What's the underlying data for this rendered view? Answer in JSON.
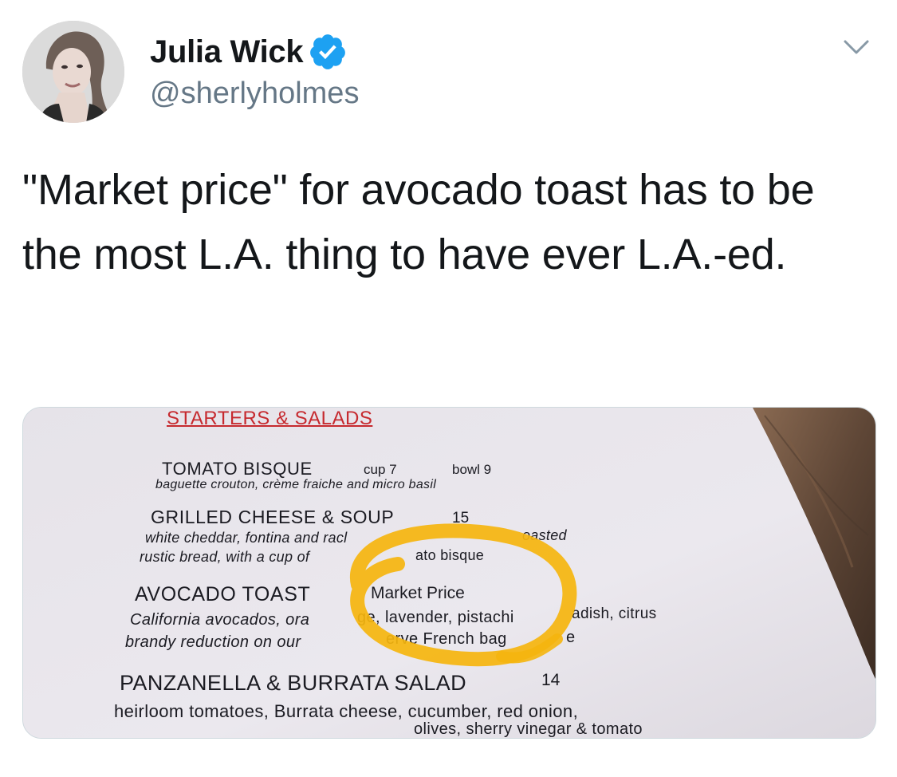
{
  "tweet": {
    "display_name": "Julia Wick",
    "handle": "@sherlyholmes",
    "text": "\"Market price\" for avocado toast has to be the most L.A. thing to have ever L.A.-ed."
  },
  "colors": {
    "verified_badge": "#1da1f2",
    "handle_gray": "#657786",
    "text_dark": "#14171a",
    "menu_red": "#c62a2f",
    "highlight_yellow": "#f5b50e"
  },
  "icons": {
    "verified": "verified-badge-icon",
    "caret": "chevron-down-icon"
  },
  "menu": {
    "section": "STARTERS & SALADS",
    "items": [
      {
        "name": "TOMATO BISQUE",
        "price_a": "cup 7",
        "price_b": "bowl 9",
        "desc": "baguette crouton, crème fraiche and micro basil"
      },
      {
        "name": "GRILLED CHEESE & SOUP",
        "price_a": "15",
        "desc_1a": "white cheddar, fontina and racl",
        "desc_1b": "oasted",
        "desc_2a": "rustic bread, with a cup of",
        "desc_2b": "ato bisque"
      },
      {
        "name": "AVOCADO TOAST",
        "price_a": "Market Price",
        "desc_1a": "California avocados, ora",
        "desc_1b": "ge, lavender, pistachi",
        "desc_1c": "adish, citrus",
        "desc_2a": "brandy reduction on our",
        "desc_2b": "erve French bag",
        "desc_2c": "e"
      },
      {
        "name": "PANZANELLA & BURRATA SALAD",
        "price_a": "14",
        "desc_1": "heirloom tomatoes, Burrata cheese, cucumber, red onion,",
        "desc_2a": "olives, sherry vinegar & tomato"
      }
    ]
  }
}
